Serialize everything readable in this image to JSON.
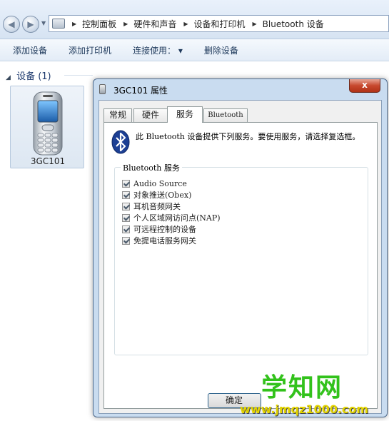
{
  "address_bar": {
    "breadcrumbs": [
      "控制面板",
      "硬件和声音",
      "设备和打印机",
      "Bluetooth 设备"
    ]
  },
  "toolbar": {
    "items": [
      "添加设备",
      "添加打印机",
      "连接使用：",
      "删除设备"
    ],
    "dropdown_glyph": "▾"
  },
  "devices_group": {
    "title": "设备 (1)",
    "toggle_glyph": "◢",
    "devices": [
      {
        "name": "3GC101"
      }
    ]
  },
  "dialog": {
    "title": "3GC101 属性",
    "close_label": "x",
    "tabs": [
      "常规",
      "硬件",
      "服务",
      "Bluetooth"
    ],
    "active_tab": "服务",
    "intro_text": "此 Bluetooth 设备提供下列服务。要使用服务，请选择复选框。",
    "services_group_title": "Bluetooth 服务",
    "services": [
      {
        "label": "Audio Source",
        "checked": true
      },
      {
        "label": "对象推送(Obex)",
        "checked": true
      },
      {
        "label": "耳机音频网关",
        "checked": true
      },
      {
        "label": "个人区域网访问点(NAP)",
        "checked": true
      },
      {
        "label": "可远程控制的设备",
        "checked": true
      },
      {
        "label": "免提电话服务网关",
        "checked": true
      }
    ],
    "ok_label": "确定"
  },
  "watermark": {
    "main": "学知网",
    "sub": "www.jmqz1000.com"
  },
  "colors": {
    "watermark_green": "#32c21b",
    "watermark_yellow": "#e3d400",
    "close_red": "#c7482d",
    "window_frame": "#c9dcf0"
  }
}
